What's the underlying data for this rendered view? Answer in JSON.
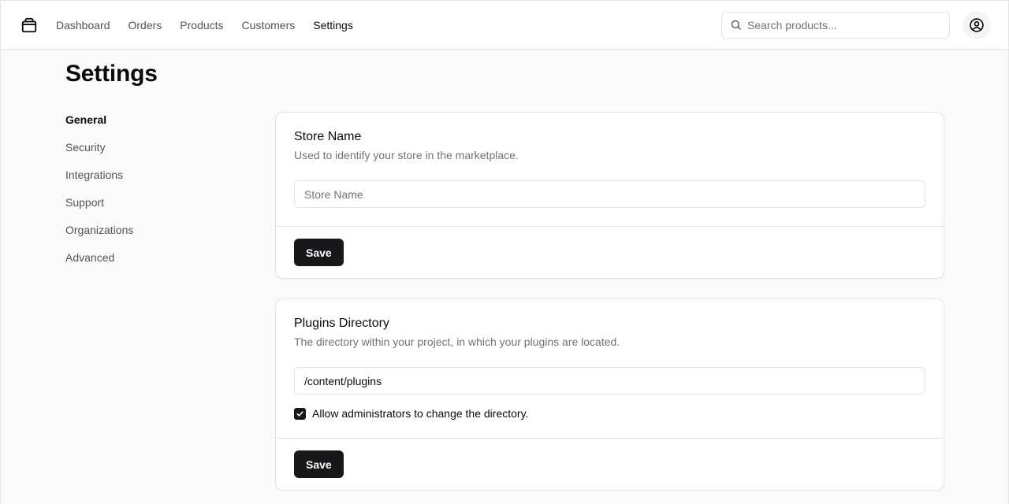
{
  "nav": {
    "items": [
      {
        "label": "Dashboard",
        "active": false
      },
      {
        "label": "Orders",
        "active": false
      },
      {
        "label": "Products",
        "active": false
      },
      {
        "label": "Customers",
        "active": false
      },
      {
        "label": "Settings",
        "active": true
      }
    ]
  },
  "search": {
    "placeholder": "Search products...",
    "value": "",
    "icon": "search-icon"
  },
  "user": {
    "icon": "user-circle-icon"
  },
  "logo": {
    "icon": "package-icon"
  },
  "page": {
    "title": "Settings"
  },
  "sidebar": {
    "items": [
      {
        "label": "General",
        "active": true
      },
      {
        "label": "Security",
        "active": false
      },
      {
        "label": "Integrations",
        "active": false
      },
      {
        "label": "Support",
        "active": false
      },
      {
        "label": "Organizations",
        "active": false
      },
      {
        "label": "Advanced",
        "active": false
      }
    ]
  },
  "store_card": {
    "title": "Store Name",
    "description": "Used to identify your store in the marketplace.",
    "input_placeholder": "Store Name",
    "input_value": "",
    "save_label": "Save"
  },
  "plugins_card": {
    "title": "Plugins Directory",
    "description": "The directory within your project, in which your plugins are located.",
    "input_value": "/content/plugins",
    "checkbox_label": "Allow administrators to change the directory.",
    "checkbox_checked": true,
    "save_label": "Save"
  },
  "colors": {
    "primary": "#18181b",
    "background": "#fafafa",
    "border": "#e4e4e7",
    "muted_text": "#71717a"
  }
}
